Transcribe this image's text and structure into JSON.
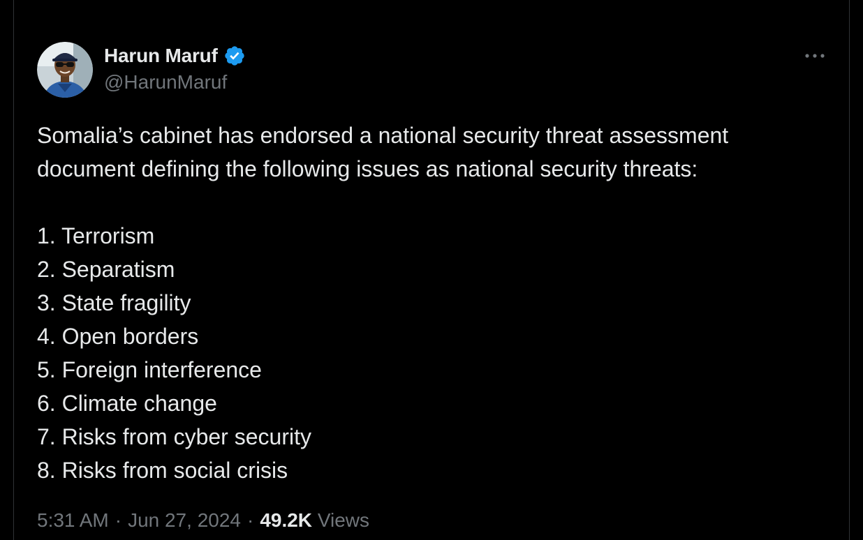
{
  "author": {
    "display_name": "Harun Maruf",
    "handle": "@HarunMaruf",
    "verified": true,
    "avatar_icon": "profile-photo-icon"
  },
  "tweet": {
    "intro_lines": [
      "Somalia’s cabinet has endorsed a national security threat assessment",
      "document defining the following issues as national security threats:"
    ],
    "items": [
      "1. Terrorism",
      "2. Separatism",
      "3. State fragility",
      "4. Open borders",
      "5. Foreign interference",
      "6. Climate change",
      "7. Risks from cyber security",
      "8. Risks from social crisis"
    ]
  },
  "meta": {
    "time": "5:31 AM",
    "date": "Jun 27, 2024",
    "separator": "·",
    "views_count": "49.2K",
    "views_label": "Views"
  },
  "colors": {
    "background": "#000000",
    "text": "#e7e9ea",
    "muted": "#71767b",
    "verified_blue": "#1d9bf0",
    "border": "#2f3336"
  }
}
